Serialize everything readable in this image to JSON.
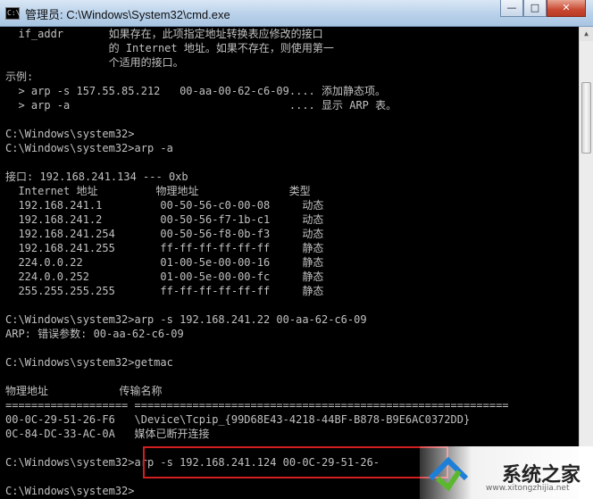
{
  "window": {
    "title": "管理员: C:\\Windows\\System32\\cmd.exe",
    "icon_label": "C:\\",
    "minimize_glyph": "—",
    "maximize_glyph": "□",
    "close_glyph": "✕"
  },
  "console": {
    "lines": [
      "  if_addr       如果存在，此项指定地址转换表应修改的接口",
      "                的 Internet 地址。如果不存在，则使用第一",
      "                个适用的接口。",
      "示例:",
      "  > arp -s 157.55.85.212   00-aa-00-62-c6-09.... 添加静态项。",
      "  > arp -a                                  .... 显示 ARP 表。",
      "",
      "C:\\Windows\\system32>",
      "C:\\Windows\\system32>arp -a",
      "",
      "接口: 192.168.241.134 --- 0xb",
      "  Internet 地址         物理地址              类型",
      "  192.168.241.1         00-50-56-c0-00-08     动态",
      "  192.168.241.2         00-50-56-f7-1b-c1     动态",
      "  192.168.241.254       00-50-56-f8-0b-f3     动态",
      "  192.168.241.255       ff-ff-ff-ff-ff-ff     静态",
      "  224.0.0.22            01-00-5e-00-00-16     静态",
      "  224.0.0.252           01-00-5e-00-00-fc     静态",
      "  255.255.255.255       ff-ff-ff-ff-ff-ff     静态",
      "",
      "C:\\Windows\\system32>arp -s 192.168.241.22 00-aa-62-c6-09",
      "ARP: 错误参数: 00-aa-62-c6-09",
      "",
      "C:\\Windows\\system32>getmac",
      "",
      "物理地址           传输名称",
      "=================== ==========================================================",
      "00-0C-29-51-26-F6   \\Device\\Tcpip_{99D68E43-4218-44BF-B878-B9E6AC0372DD}",
      "0C-84-DC-33-AC-0A   媒体已断开连接",
      "",
      "C:\\Windows\\system32>arp -s 192.168.241.124 00-0C-29-51-26-",
      "",
      "C:\\Windows\\system32>"
    ]
  },
  "watermark": {
    "text": "系统之家",
    "url": "www.xitongzhijia.net",
    "colors": {
      "blue": "#1e7fd8",
      "green": "#5bb82e"
    }
  },
  "colors": {
    "console_bg": "#000000",
    "console_text": "#c0c0c0",
    "highlight_border": "#d21e1e"
  }
}
